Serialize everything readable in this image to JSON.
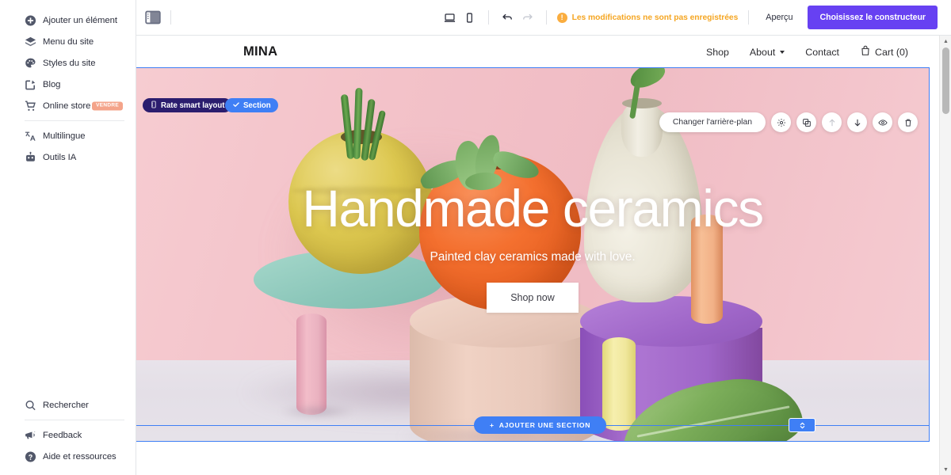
{
  "sidebar": {
    "top_items": [
      {
        "label": "Ajouter un élément",
        "icon": "plus-circle-icon"
      },
      {
        "label": "Menu du site",
        "icon": "layers-icon"
      },
      {
        "label": "Styles du site",
        "icon": "palette-icon"
      },
      {
        "label": "Blog",
        "icon": "edit-square-icon"
      },
      {
        "label": "Online store",
        "icon": "shopping-cart-icon",
        "badge": "VENDRE"
      },
      {
        "label": "Multilingue",
        "icon": "translate-icon"
      },
      {
        "label": "Outils IA",
        "icon": "robot-icon"
      }
    ],
    "bottom_items": [
      {
        "label": "Rechercher",
        "icon": "search-icon"
      },
      {
        "label": "Feedback",
        "icon": "megaphone-icon"
      },
      {
        "label": "Aide et ressources",
        "icon": "help-circle-icon"
      }
    ]
  },
  "toolbar": {
    "panel_toggle_icon": "sidebar-panel-icon",
    "desktop_icon": "desktop-icon",
    "mobile_icon": "mobile-icon",
    "undo_icon": "undo-icon",
    "redo_icon": "redo-icon",
    "warning_mark": "!",
    "warning_text": "Les modifications ne sont pas enregistrées",
    "preview_label": "Aperçu",
    "cta_label": "Choisissez le constructeur",
    "accent_purple": "#6741f2",
    "warning_color": "#f5a623"
  },
  "site": {
    "logo": "MINA",
    "nav": [
      {
        "label": "Shop",
        "has_caret": false
      },
      {
        "label": "About",
        "has_caret": true
      },
      {
        "label": "Contact",
        "has_caret": false
      }
    ],
    "cart_label": "Cart (0)",
    "cart_icon": "bag-icon"
  },
  "hero": {
    "title": "Handmade ceramics",
    "subtitle": "Painted clay ceramics made with love.",
    "button_label": "Shop now",
    "background_description": "Pastel studio photo of handmade ceramic vases and cylinders on colored podiums",
    "colors": {
      "wall": "#f2c2ca",
      "floor": "#e6e1e8",
      "yellow_vase": "#ddc850",
      "orange_vase": "#f06a2c",
      "cream_vase": "#e8e4d6",
      "mint_podium": "#8fc8bd",
      "blush_podium": "#e7c6b8",
      "purple_podium": "#9e63c9",
      "pink_cylinder": "#edb0bf",
      "peach_cylinder": "#f3b188",
      "lemon_cylinder": "#f1e79c",
      "leaf_green": "#7fae5c"
    }
  },
  "editor_overlay": {
    "smart_layout_chip": "Rate smart layout",
    "smart_layout_icon": "ruler-icon",
    "section_chip": "Section",
    "section_chip_icon": "check-icon",
    "change_background_label": "Changer l'arrière-plan",
    "actions": [
      {
        "name": "settings-icon",
        "disabled": false
      },
      {
        "name": "duplicate-icon",
        "disabled": false
      },
      {
        "name": "move-up-icon",
        "disabled": true
      },
      {
        "name": "move-down-icon",
        "disabled": false
      },
      {
        "name": "hide-eye-icon",
        "disabled": false
      },
      {
        "name": "delete-trash-icon",
        "disabled": false
      }
    ],
    "add_section_label": "AJOUTER UNE SECTION",
    "add_section_plus": "+",
    "selection_color": "#3f7ff5"
  },
  "scrollbar": {
    "up_arrow": "▲",
    "down_arrow": "▼"
  }
}
